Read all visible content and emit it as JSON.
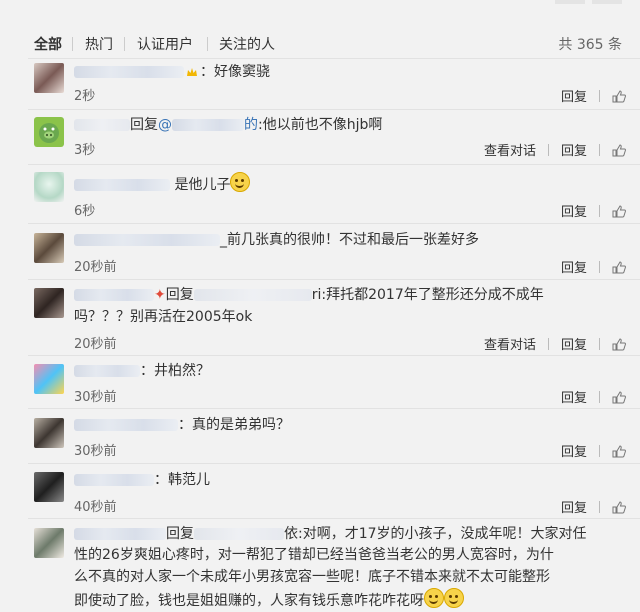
{
  "tabs": {
    "items": [
      "全部",
      "热门",
      "认证用户",
      "关注的人"
    ],
    "total": "共 365 条"
  },
  "labels": {
    "reply_action": "回复",
    "view_dialog": "查看对话",
    "reply_prefix": "回复",
    "at": "@"
  },
  "comments": [
    {
      "text": "：好像窦骁",
      "time": "2秒",
      "has_dialog": false,
      "avatar": "avatar-woman-icon"
    },
    {
      "text": ":他以前也不像hjb啊",
      "time": "3秒",
      "has_dialog": true,
      "reply_tail": "的",
      "avatar": "green-pig-icon"
    },
    {
      "text": "是他儿子",
      "time": "6秒",
      "has_dialog": false,
      "avatar": "avatar-cartoon-icon"
    },
    {
      "text": "_前几张真的很帅！不过和最后一张差好多",
      "time": "20秒前",
      "has_dialog": false,
      "avatar": "avatar-girl-icon"
    },
    {
      "text_line1": "ri:拜托都2017年了整形还分成不成年",
      "text_line2": "吗？？？别再活在2005年ok",
      "time": "20秒前",
      "has_dialog": true,
      "avatar": "avatar-man-icon"
    },
    {
      "text": "：井柏然？",
      "time": "30秒前",
      "has_dialog": false,
      "avatar": "avatar-colorful-icon"
    },
    {
      "text": "：真的是弟弟吗？",
      "time": "30秒前",
      "has_dialog": false,
      "avatar": "avatar-boy-icon"
    },
    {
      "text": "：韩范儿",
      "time": "40秒前",
      "has_dialog": false,
      "avatar": "avatar-dark-icon"
    },
    {
      "line1_tail": "依:对啊，才17岁的小孩子，没成年呢！大家对任",
      "line2": "性的26岁爽姐心疼时，对一帮犯了错却已经当爸爸当老公的男人宽容时，为什",
      "line3": "么不真的对人家一个未成年小男孩宽容一些呢！底子不错本来就不太可能整形",
      "line4": "即使动了脸，钱也是姐姐赚的，人家有钱乐意咋花咋花呀",
      "avatar": "avatar-child-icon"
    }
  ]
}
